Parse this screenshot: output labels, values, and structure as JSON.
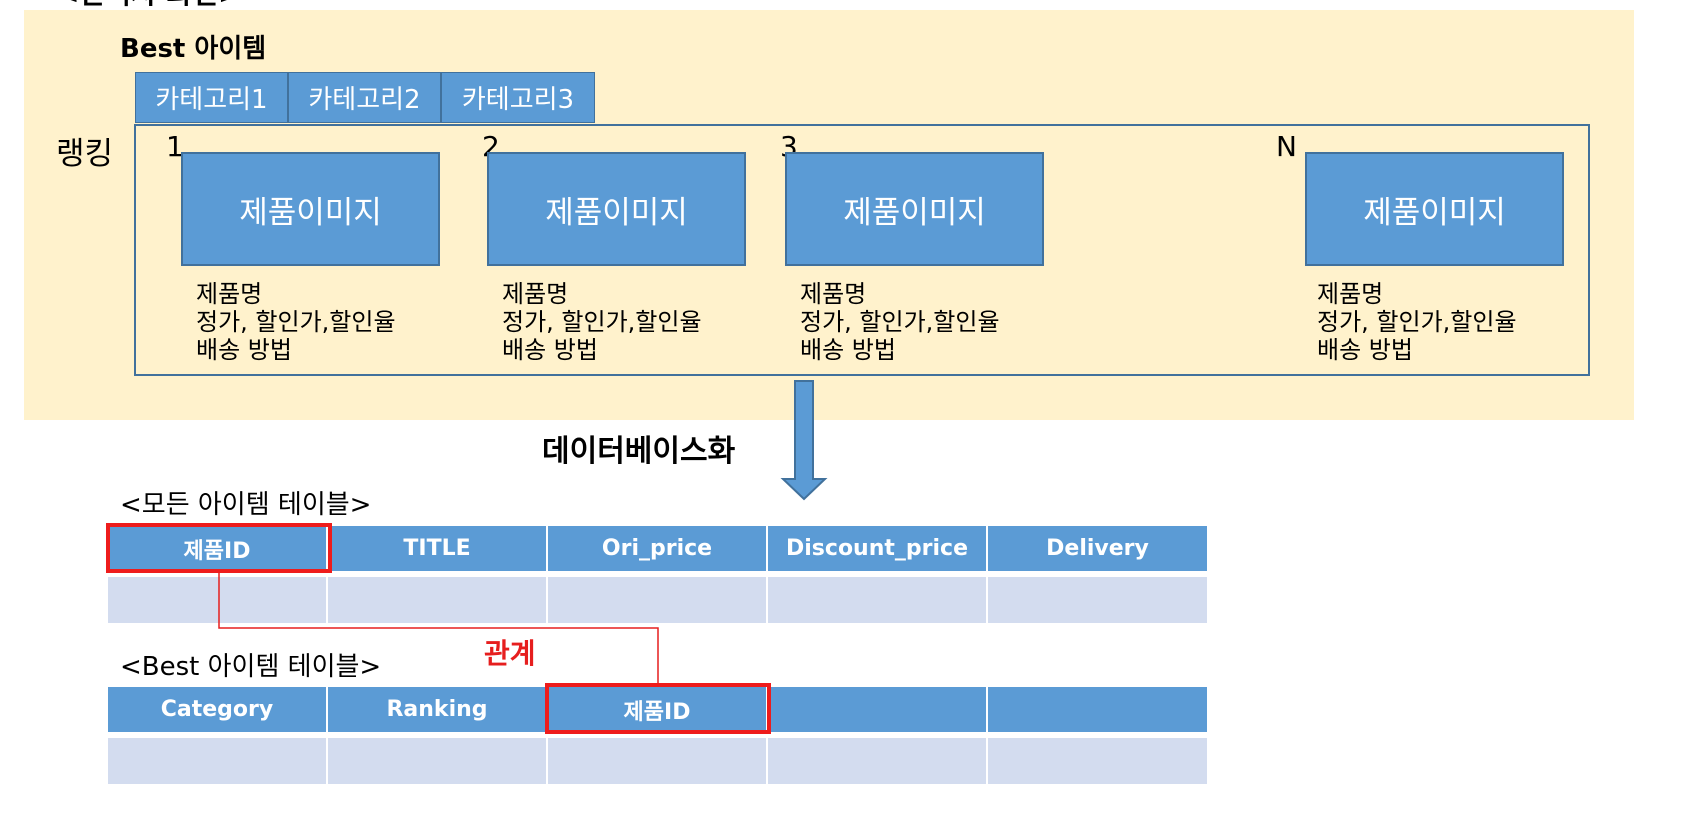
{
  "screen_title": "<관리자 화면>",
  "best_section": {
    "title": "Best 아이템",
    "ranking_label": "랭킹",
    "tabs": [
      "카테고리1",
      "카테고리2",
      "카테고리3"
    ],
    "products": [
      {
        "rank": "1",
        "image_label": "제품이미지",
        "name": "제품명",
        "price": "정가, 할인가,할인율",
        "delivery": "배송 방법"
      },
      {
        "rank": "2",
        "image_label": "제품이미지",
        "name": "제품명",
        "price": "정가, 할인가,할인율",
        "delivery": "배송 방법"
      },
      {
        "rank": "3",
        "image_label": "제품이미지",
        "name": "제품명",
        "price": "정가, 할인가,할인율",
        "delivery": "배송 방법"
      },
      {
        "rank": "N",
        "image_label": "제품이미지",
        "name": "제품명",
        "price": "정가, 할인가,할인율",
        "delivery": "배송 방법"
      }
    ]
  },
  "database_label": "데이터베이스화",
  "all_items_table": {
    "title": "<모든 아이템 테이블>",
    "columns": [
      "제품ID",
      "TITLE",
      "Ori_price",
      "Discount_price",
      "Delivery"
    ]
  },
  "relation_label": "관계",
  "best_items_table": {
    "title": "<Best 아이템 테이블>",
    "columns": [
      "Category",
      "Ranking",
      "제품ID",
      "",
      ""
    ]
  },
  "colors": {
    "panel_bg": "#fff2cc",
    "box_blue": "#5b9bd5",
    "box_border": "#41719c",
    "table_body": "#d3dcef",
    "highlight_red": "#ee1c1c"
  }
}
